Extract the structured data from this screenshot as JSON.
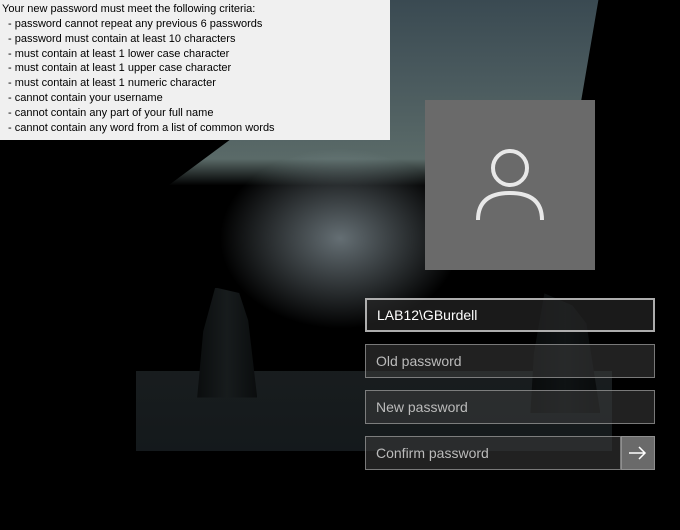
{
  "criteria": {
    "title": "Your new password must meet the following criteria:",
    "items": [
      "- password cannot repeat any previous 6 passwords",
      "- password must contain at least 10 characters",
      "- must contain at least 1 lower case character",
      "- must contain at least 1 upper case character",
      "- must contain at least 1 numeric character",
      "- cannot contain your username",
      "- cannot contain any part of your full name",
      "- cannot contain any word from a list of common words"
    ]
  },
  "login": {
    "username_value": "LAB12\\GBurdell",
    "old_password_placeholder": "Old password",
    "new_password_placeholder": "New password",
    "confirm_password_placeholder": "Confirm password"
  }
}
